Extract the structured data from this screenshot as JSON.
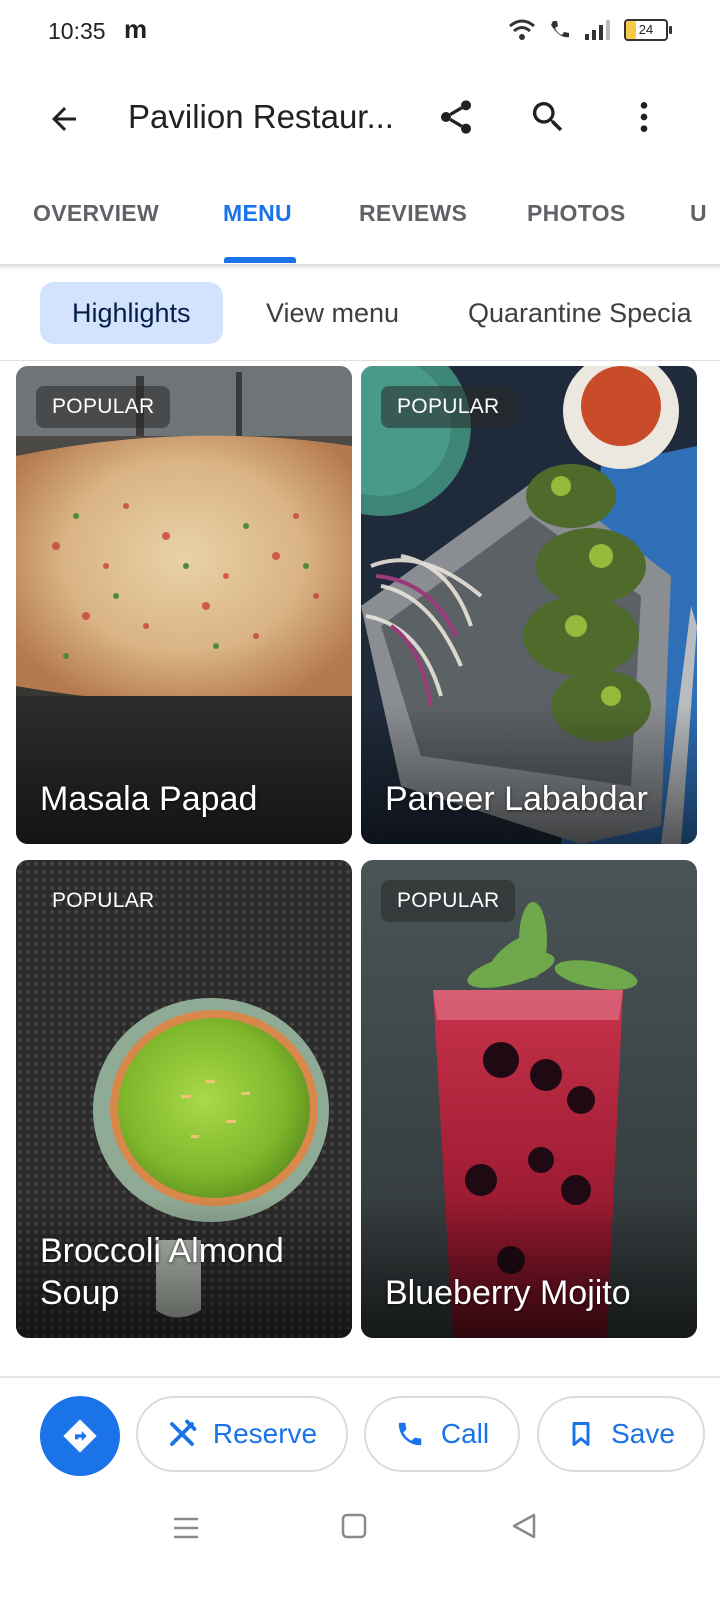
{
  "status_bar": {
    "time": "10:35",
    "app_indicator": "m",
    "battery": "24",
    "battery_level": 0.24
  },
  "app_bar": {
    "title": "Pavilion Restaur...",
    "icons": [
      "back-arrow-icon",
      "share-icon",
      "search-icon",
      "more-vert-icon"
    ]
  },
  "tabs": [
    {
      "label": "OVERVIEW",
      "active": false
    },
    {
      "label": "MENU",
      "active": true
    },
    {
      "label": "REVIEWS",
      "active": false
    },
    {
      "label": "PHOTOS",
      "active": false
    },
    {
      "label": "U",
      "active": false
    }
  ],
  "chips": [
    {
      "label": "Highlights",
      "active": true
    },
    {
      "label": "View menu",
      "active": false
    },
    {
      "label": "Quarantine Specia",
      "active": false
    }
  ],
  "menu_items": [
    {
      "badge": "POPULAR",
      "name": "Masala Papad",
      "image": "masala-papad-photo"
    },
    {
      "badge": "POPULAR",
      "name": "Paneer Lababdar",
      "image": "paneer-lababdar-photo"
    },
    {
      "badge": "POPULAR",
      "name": "Broccoli Almond Soup",
      "image": "broccoli-almond-soup-photo"
    },
    {
      "badge": "POPULAR",
      "name": "Blueberry Mojito",
      "image": "blueberry-mojito-photo"
    }
  ],
  "actions": {
    "directions_icon": "directions-icon",
    "reserve": "Reserve",
    "call": "Call",
    "save": "Save"
  },
  "colors": {
    "accent": "#1a73e8",
    "chip_active_bg": "#d3e3fd"
  }
}
